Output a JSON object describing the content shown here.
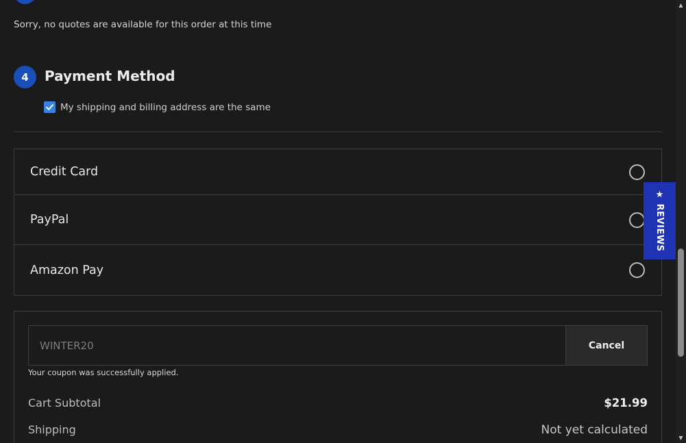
{
  "shipping": {
    "note": "Sorry, no quotes are available for this order at this time"
  },
  "payment": {
    "step_number": "4",
    "title": "Payment Method",
    "billing_same_label": "My shipping and billing address are the same",
    "billing_same_checked": true,
    "methods": [
      {
        "label": "Credit Card",
        "selected": false
      },
      {
        "label": "PayPal",
        "selected": false
      },
      {
        "label": "Amazon Pay",
        "selected": false
      }
    ]
  },
  "coupon": {
    "value": "WINTER20",
    "cancel_label": "Cancel",
    "message": "Your coupon was successfully applied."
  },
  "summary": {
    "subtotal_label": "Cart Subtotal",
    "subtotal_value": "$21.99",
    "shipping_label": "Shipping",
    "shipping_value": "Not yet calculated"
  },
  "reviews_tab": {
    "label": "★ REVIEWS"
  },
  "colors": {
    "accent": "#1a4fb8",
    "checkbox": "#3b82e0",
    "reviews_tab": "#1f33b4",
    "background": "#1b1b1b"
  }
}
